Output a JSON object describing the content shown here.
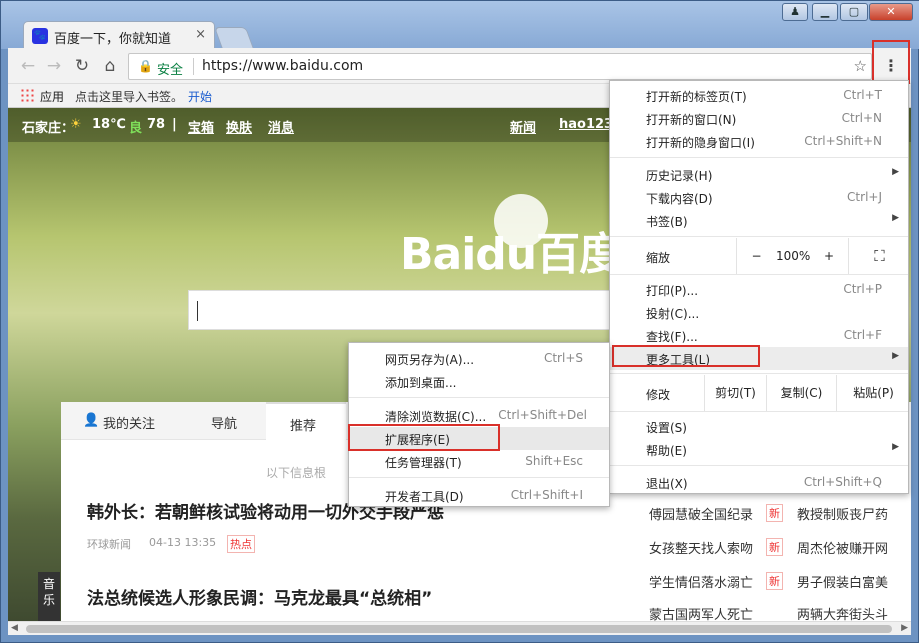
{
  "window": {
    "tab_title": "百度一下，你就知道",
    "tab_close": "×",
    "user": "♟",
    "minimize": "▁",
    "maximize": "▢",
    "close": "✕"
  },
  "toolbar": {
    "back": "←",
    "forward": "→",
    "reload": "↻",
    "home": "⌂",
    "lock": "🔒",
    "secure": "安全",
    "url": "https://www.baidu.com",
    "star": "☆",
    "menu": "⋮"
  },
  "bookmarks": {
    "apps": "应用",
    "hint": "点击这里导入书签。",
    "start": "开始"
  },
  "page": {
    "topbar": {
      "city": "石家庄：",
      "weather": "☀",
      "temp": "18℃",
      "aq_label": "良",
      "aq_value": "78",
      "sep": "|",
      "baoxiang": "宝箱",
      "huanfu": "换肤",
      "xiaoxi": "消息",
      "news": "新闻",
      "hao123": "hao123"
    },
    "logo": "Baidu百度",
    "feed": {
      "tab_follow": "我的关注",
      "tab_nav": "导航",
      "tab_rec": "推荐",
      "hint": "以下信息根",
      "news1_title": "韩外长：若朝鲜核试验将动用一切外交手段严惩",
      "news1_source": "环球新闻",
      "news1_time": "04-13 13:35",
      "news1_tag": "热点",
      "news2_title": "法总统候选人形象民调：马克龙最具“总统相”",
      "music": "音乐"
    },
    "hot": [
      {
        "text": "傅园慧破全国纪录",
        "badge": "新"
      },
      {
        "text": "教授制贩丧尸药",
        "badge": ""
      },
      {
        "text": "女孩整天找人索吻",
        "badge": "新"
      },
      {
        "text": "周杰伦被赚开网",
        "badge": ""
      },
      {
        "text": "学生情侣落水溺亡",
        "badge": "新"
      },
      {
        "text": "男子假装白富美",
        "badge": ""
      },
      {
        "text": "蒙古国两军人死亡",
        "badge": ""
      },
      {
        "text": "两辆大奔街头斗",
        "badge": ""
      }
    ]
  },
  "menu": {
    "new_tab": "打开新的标签页(T)",
    "new_tab_sc": "Ctrl+T",
    "new_window": "打开新的窗口(N)",
    "new_window_sc": "Ctrl+N",
    "incognito": "打开新的隐身窗口(I)",
    "incognito_sc": "Ctrl+Shift+N",
    "history": "历史记录(H)",
    "downloads": "下载内容(D)",
    "downloads_sc": "Ctrl+J",
    "bookmarks": "书签(B)",
    "zoom": "缩放",
    "zoom_minus": "−",
    "zoom_value": "100%",
    "zoom_plus": "+",
    "fullscreen": "⛶",
    "print": "打印(P)...",
    "print_sc": "Ctrl+P",
    "cast": "投射(C)...",
    "find": "查找(F)...",
    "find_sc": "Ctrl+F",
    "more_tools": "更多工具(L)",
    "edit": "修改",
    "cut": "剪切(T)",
    "copy": "复制(C)",
    "paste": "粘贴(P)",
    "settings": "设置(S)",
    "help": "帮助(E)",
    "exit": "退出(X)",
    "exit_sc": "Ctrl+Shift+Q",
    "arrow": "▶"
  },
  "submenu": {
    "save_as": "网页另存为(A)...",
    "save_as_sc": "Ctrl+S",
    "add_desktop": "添加到桌面...",
    "clear_data": "清除浏览数据(C)...",
    "clear_data_sc": "Ctrl+Shift+Del",
    "extensions": "扩展程序(E)",
    "task_manager": "任务管理器(T)",
    "task_manager_sc": "Shift+Esc",
    "dev_tools": "开发者工具(D)",
    "dev_tools_sc": "Ctrl+Shift+I"
  },
  "scroll": {
    "left": "◀",
    "right": "▶"
  },
  "colors": {
    "accent": "#d9302a",
    "secure_green": "#0b8043",
    "link_blue": "#1a5ccf"
  }
}
